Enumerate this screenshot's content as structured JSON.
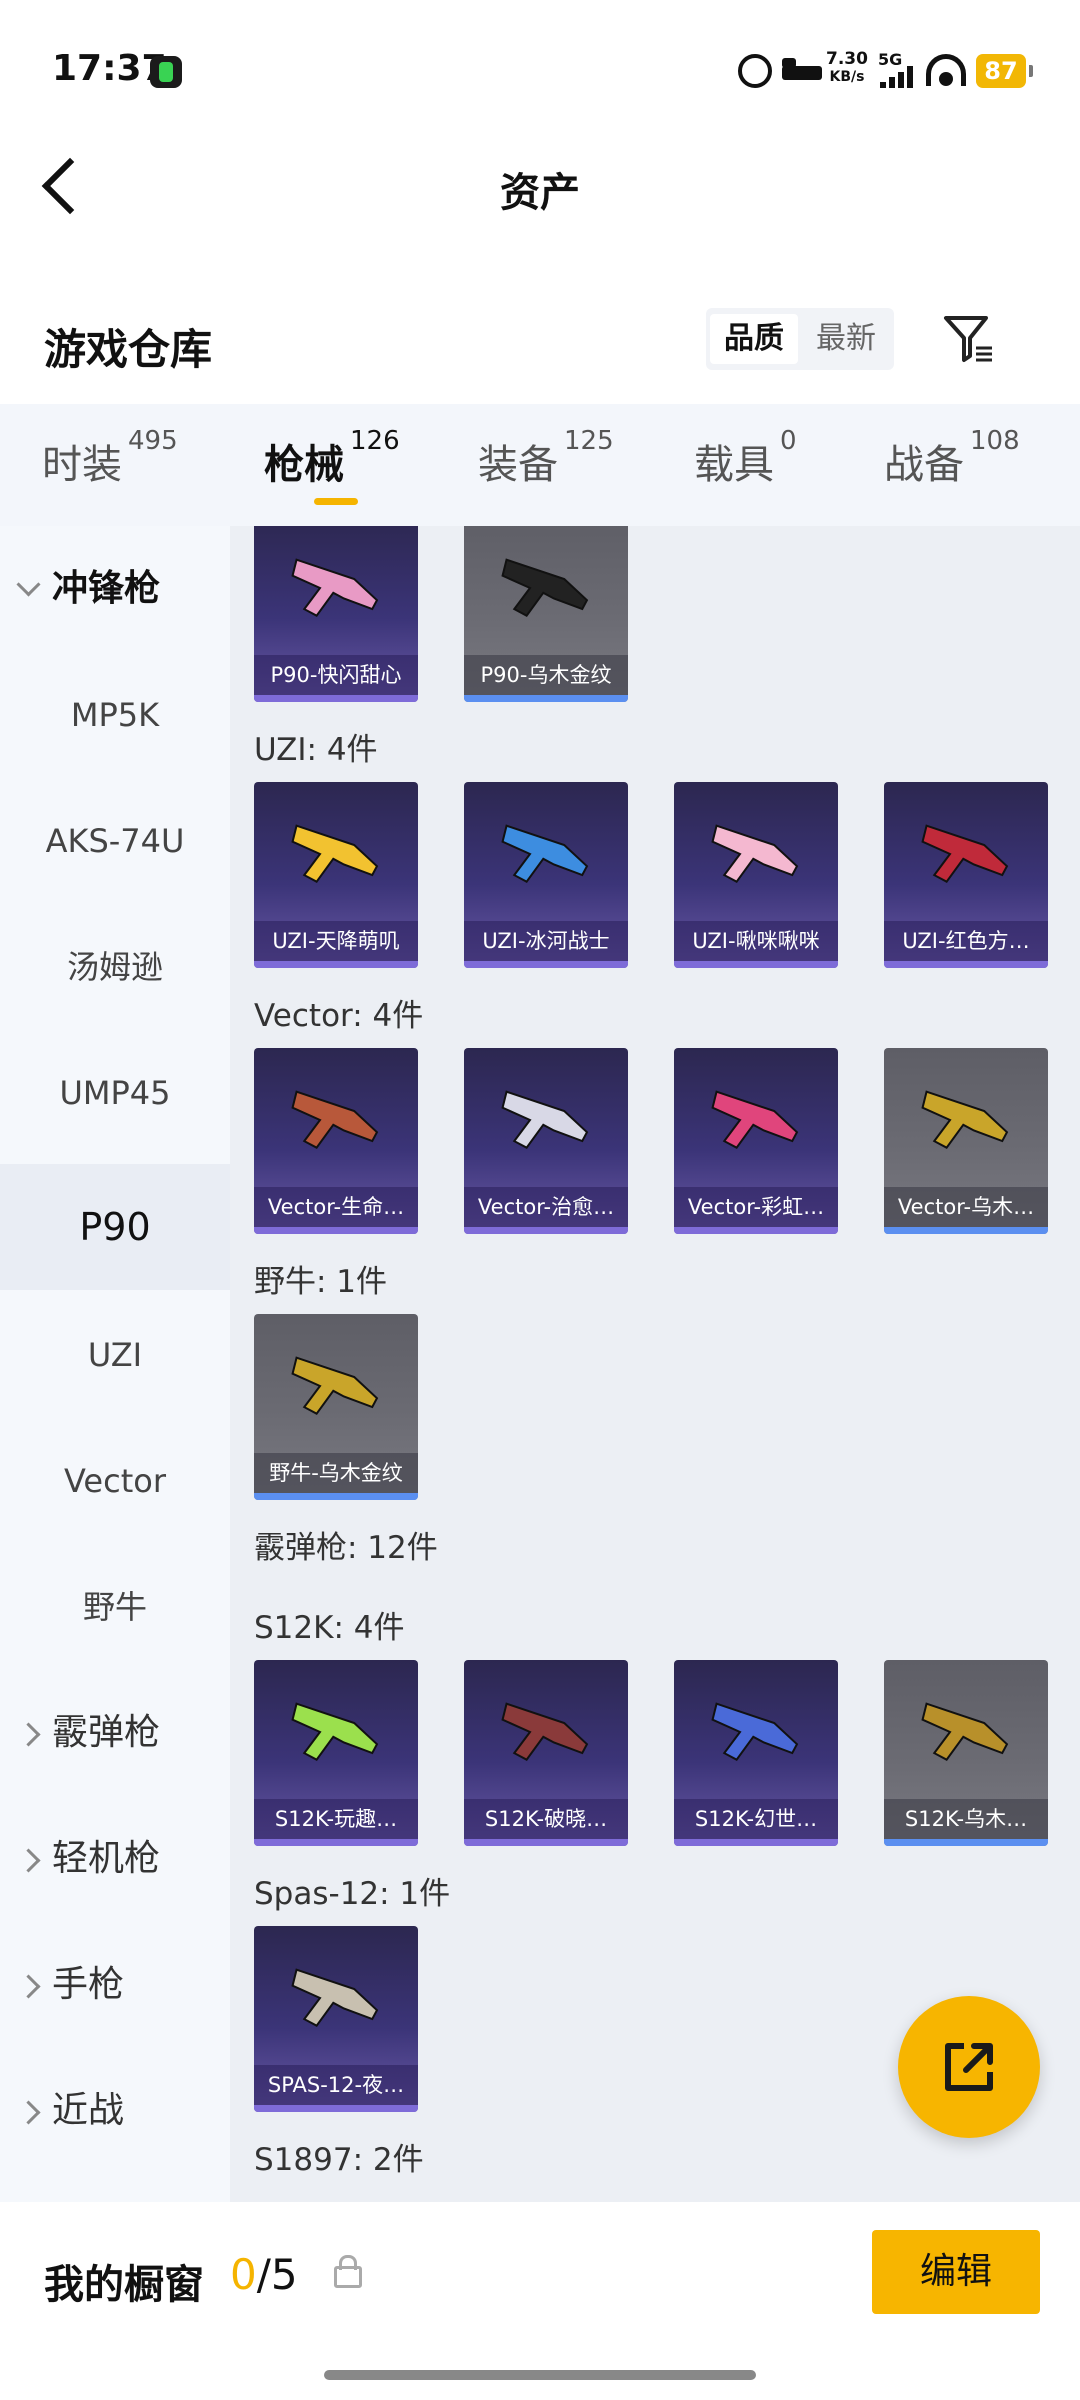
{
  "status_bar": {
    "time": "17:37",
    "net_speed_value": "7.30",
    "net_speed_unit": "KB/s",
    "network": "5G",
    "battery": "87",
    "icons": [
      "app-icon",
      "alarm-icon",
      "bed-icon",
      "signal-icon",
      "wifi-icon",
      "battery-icon"
    ]
  },
  "header": {
    "title": "资产",
    "back_icon": "chevron-left-icon"
  },
  "warehouse": {
    "title": "游戏仓库",
    "sort_options": [
      "品质",
      "最新"
    ],
    "sort_selected": "品质",
    "filter_icon": "filter-icon"
  },
  "tabs": [
    {
      "label": "时装",
      "count": "495"
    },
    {
      "label": "枪械",
      "count": "126",
      "active": true
    },
    {
      "label": "装备",
      "count": "125"
    },
    {
      "label": "载具",
      "count": "0"
    },
    {
      "label": "战备",
      "count": "108"
    }
  ],
  "sidebar": {
    "items": [
      {
        "label": "冲锋枪",
        "type": "group",
        "expanded": true
      },
      {
        "label": "MP5K"
      },
      {
        "label": "AKS-74U"
      },
      {
        "label": "汤姆逊"
      },
      {
        "label": "UMP45"
      },
      {
        "label": "P90",
        "selected": true
      },
      {
        "label": "UZI"
      },
      {
        "label": "Vector"
      },
      {
        "label": "野牛"
      },
      {
        "label": "霰弹枪",
        "type": "group"
      },
      {
        "label": "轻机枪",
        "type": "group"
      },
      {
        "label": "手枪",
        "type": "group"
      },
      {
        "label": "近战",
        "type": "group"
      }
    ]
  },
  "content": {
    "sections": [
      {
        "label": "",
        "items": [
          "P90-快闪甜心",
          "P90-乌木金纹"
        ]
      },
      {
        "label": "UZI: 4件",
        "items": [
          "UZI-天降萌叽",
          "UZI-冰河战士",
          "UZI-啾咪啾咪",
          "UZI-红色方…"
        ]
      },
      {
        "label": "Vector: 4件",
        "items": [
          "Vector-生命…",
          "Vector-治愈…",
          "Vector-彩虹…",
          "Vector-乌木…"
        ]
      },
      {
        "label": "野牛: 1件",
        "items": [
          "野牛-乌木金纹"
        ]
      },
      {
        "label": "霰弹枪: 12件",
        "items": []
      },
      {
        "label": "S12K: 4件",
        "items": [
          "S12K-玩趣…",
          "S12K-破晓…",
          "S12K-幻世…",
          "S12K-乌木…"
        ]
      },
      {
        "label": "Spas-12: 1件",
        "items": [
          "SPAS-12-夜…"
        ]
      },
      {
        "label": "S1897: 2件",
        "items": []
      }
    ],
    "share_icon": "share-icon"
  },
  "bottom_bar": {
    "showcase_label": "我的橱窗",
    "showcase_current": "0",
    "showcase_total": "/5",
    "lock_icon": "lock-icon",
    "edit_label": "编辑"
  }
}
